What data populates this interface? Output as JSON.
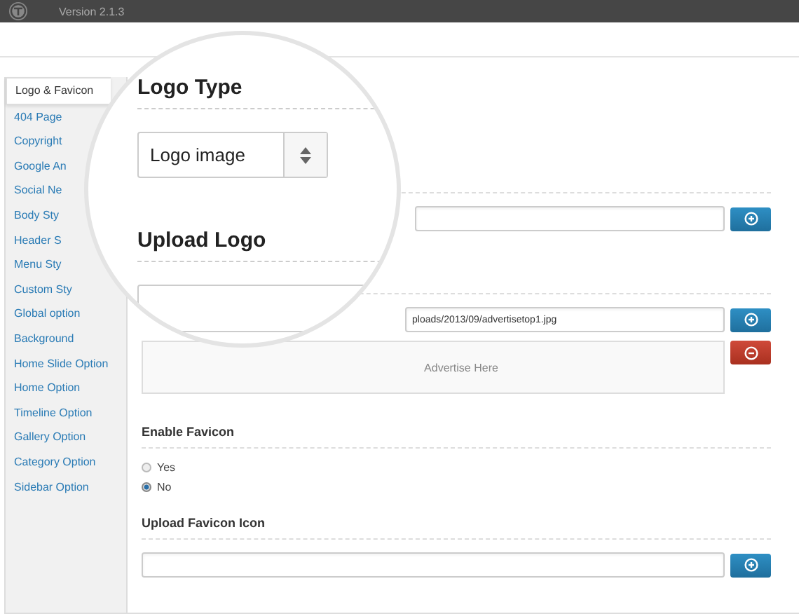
{
  "header": {
    "version": "Version 2.1.3"
  },
  "sidebar": {
    "items": [
      {
        "label": "Logo & Favicon",
        "selected": true
      },
      {
        "label": "404 Page",
        "selected": false
      },
      {
        "label": "Copyright",
        "selected": false
      },
      {
        "label": "Google An",
        "selected": false
      },
      {
        "label": "Social Ne",
        "selected": false
      },
      {
        "label": "Body Sty",
        "selected": false
      },
      {
        "label": "Header S",
        "selected": false
      },
      {
        "label": "Menu Sty",
        "selected": false
      },
      {
        "label": "Custom Sty",
        "selected": false
      },
      {
        "label": "Global option",
        "selected": false
      },
      {
        "label": "Background",
        "selected": false
      },
      {
        "label": "Home Slide Option",
        "selected": false
      },
      {
        "label": "Home Option",
        "selected": false
      },
      {
        "label": "Timeline Option",
        "selected": false
      },
      {
        "label": "Gallery Option",
        "selected": false
      },
      {
        "label": "Category Option",
        "selected": false
      },
      {
        "label": "Sidebar Option",
        "selected": false
      }
    ]
  },
  "magnifier": {
    "logo_type": {
      "heading": "Logo Type",
      "select_value": "Logo image"
    },
    "upload_logo": {
      "heading": "Upload Logo"
    }
  },
  "upload_logo": {
    "url_value": "ploads/2013/09/advertisetop1.jpg",
    "preview_text": "Advertise Here"
  },
  "enable_favicon": {
    "heading": "Enable Favicon",
    "options": [
      {
        "label": "Yes",
        "selected": false
      },
      {
        "label": "No",
        "selected": true
      }
    ]
  },
  "upload_favicon": {
    "heading": "Upload Favicon Icon"
  }
}
